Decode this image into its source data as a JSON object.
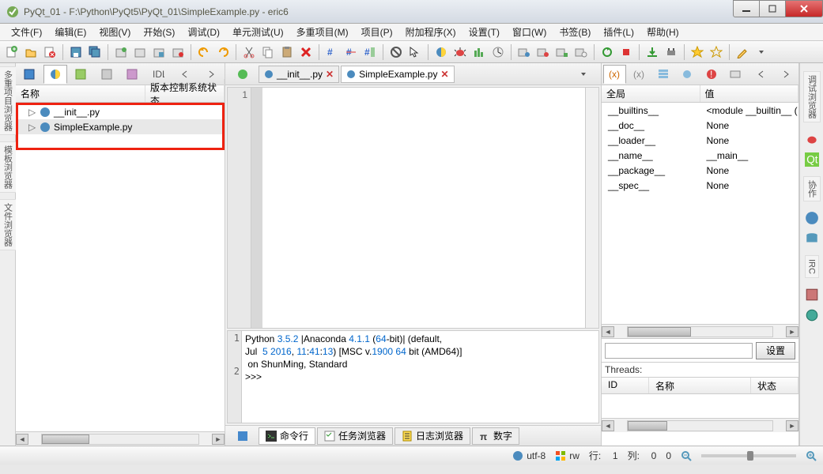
{
  "window": {
    "title": "PyQt_01 - F:\\Python\\PyQt5\\PyQt_01\\SimpleExample.py - eric6"
  },
  "menu": [
    "文件(F)",
    "编辑(E)",
    "视图(V)",
    "开始(S)",
    "调试(D)",
    "单元测试(U)",
    "多重项目(M)",
    "项目(P)",
    "附加程序(X)",
    "设置(T)",
    "窗口(W)",
    "书签(B)",
    "插件(L)",
    "帮助(H)"
  ],
  "tree": {
    "headers": {
      "name": "名称",
      "vcs": "版本控制系统状态"
    },
    "items": [
      {
        "label": "__init__.py",
        "selected": false
      },
      {
        "label": "SimpleExample.py",
        "selected": true
      }
    ]
  },
  "editorTabs": [
    {
      "label": "__init__.py",
      "active": false
    },
    {
      "label": "SimpleExample.py",
      "active": true
    }
  ],
  "editor": {
    "firstLine": "1"
  },
  "console": {
    "line1_a": "Python ",
    "line1_b": "3.5.2",
    "line1_c": " |Anaconda ",
    "line1_d": "4.1.1",
    "line1_e": " (",
    "line1_f": "64",
    "line1_g": "-bit)| (default,",
    "line2_a": "Jul  ",
    "line2_b": "5 2016",
    "line2_c": ", ",
    "line2_d": "11",
    "line2_e": ":",
    "line2_f": "41",
    "line2_g": ":",
    "line2_h": "13",
    "line2_i": ") [MSC v.",
    "line2_j": "1900 64",
    "line2_k": " bit (AMD64)]",
    "line3": " on ShunMing, Standard",
    "prompt": ">>> "
  },
  "bottomTabs": [
    {
      "label": "命令行",
      "active": true
    },
    {
      "label": "任务浏览器",
      "active": false
    },
    {
      "label": "日志浏览器",
      "active": false
    },
    {
      "label": "数字",
      "active": false
    }
  ],
  "vars": {
    "headers": {
      "global": "全局",
      "value": "值"
    },
    "rows": [
      {
        "name": "__builtins__",
        "value": "<module __builtin__ ("
      },
      {
        "name": "__doc__",
        "value": "None"
      },
      {
        "name": "__loader__",
        "value": "None"
      },
      {
        "name": "__name__",
        "value": "__main__"
      },
      {
        "name": "__package__",
        "value": "None"
      },
      {
        "name": "__spec__",
        "value": "None"
      }
    ],
    "settingsBtn": "设置"
  },
  "threads": {
    "label": "Threads:",
    "headers": {
      "id": "ID",
      "name": "名称",
      "state": "状态"
    }
  },
  "status": {
    "encoding": "utf-8",
    "mode": "rw",
    "lineLabel": "行:",
    "line": "1",
    "colLabel": "列:",
    "col": "0",
    "zoom": "0"
  },
  "sideTabs": {
    "multi": "多重项目浏览器",
    "tpl": "模板浏览器",
    "file": "文件浏览器",
    "debug": "调试浏览器",
    "coop": "协作",
    "irc": "IRC"
  }
}
